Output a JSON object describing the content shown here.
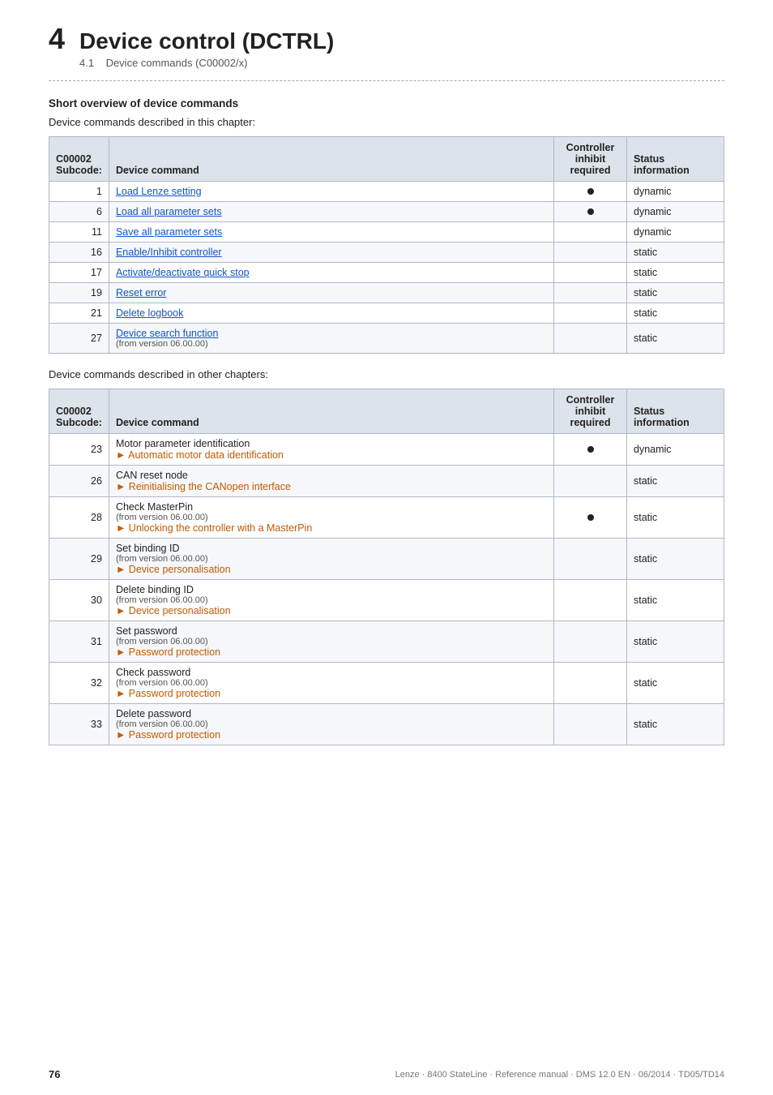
{
  "chapter": {
    "number": "4",
    "title": "Device control (DCTRL)",
    "section_number": "4.1",
    "section_title": "Device commands (C00002/x)"
  },
  "section1": {
    "bold_title": "Short overview of device commands",
    "intro": "Device commands described in this chapter:"
  },
  "table1": {
    "headers": {
      "subcode": "C00002\nSubcode:",
      "command": "Device command",
      "inhibit": "Controller\ninhibit\nrequired",
      "status": "Status information"
    },
    "rows": [
      {
        "subcode": "1",
        "command": "Load Lenze setting",
        "inhibit": true,
        "status": "dynamic",
        "link": true
      },
      {
        "subcode": "6",
        "command": "Load all parameter sets",
        "inhibit": true,
        "status": "dynamic",
        "link": true
      },
      {
        "subcode": "11",
        "command": "Save all parameter sets",
        "inhibit": false,
        "status": "dynamic",
        "link": true
      },
      {
        "subcode": "16",
        "command": "Enable/Inhibit controller",
        "inhibit": false,
        "status": "static",
        "link": true
      },
      {
        "subcode": "17",
        "command": "Activate/deactivate quick stop",
        "inhibit": false,
        "status": "static",
        "link": true
      },
      {
        "subcode": "19",
        "command": "Reset error",
        "inhibit": false,
        "status": "static",
        "link": true
      },
      {
        "subcode": "21",
        "command": "Delete logbook",
        "inhibit": false,
        "status": "static",
        "link": true
      },
      {
        "subcode": "27",
        "command_main": "Device search function",
        "command_sub": "(from version 06.00.00)",
        "inhibit": false,
        "status": "static",
        "link": true,
        "has_sub": true
      }
    ]
  },
  "section2": {
    "intro": "Device commands described in other chapters:"
  },
  "table2": {
    "headers": {
      "subcode": "C00002\nSubcode:",
      "command": "Device command",
      "inhibit": "Controller\ninhibit\nrequired",
      "status": "Status information"
    },
    "rows": [
      {
        "subcode": "23",
        "command_main": "Motor parameter identification",
        "command_sub": null,
        "command_link": "▶ Automatic motor data identification",
        "inhibit": true,
        "status": "dynamic"
      },
      {
        "subcode": "26",
        "command_main": "CAN reset node",
        "command_sub": null,
        "command_link": "▶ Reinitialising the CANopen interface",
        "inhibit": false,
        "status": "static"
      },
      {
        "subcode": "28",
        "command_main": "Check MasterPin",
        "command_sub": "(from version 06.00.00)",
        "command_link": "▶ Unlocking the controller with a MasterPin",
        "inhibit": true,
        "status": "static"
      },
      {
        "subcode": "29",
        "command_main": "Set binding ID",
        "command_sub": "(from version 06.00.00)",
        "command_link": "▶ Device personalisation",
        "inhibit": false,
        "status": "static"
      },
      {
        "subcode": "30",
        "command_main": "Delete binding ID",
        "command_sub": "(from version 06.00.00)",
        "command_link": "▶ Device personalisation",
        "inhibit": false,
        "status": "static"
      },
      {
        "subcode": "31",
        "command_main": "Set password",
        "command_sub": "(from version 06.00.00)",
        "command_link": "▶ Password protection",
        "inhibit": false,
        "status": "static"
      },
      {
        "subcode": "32",
        "command_main": "Check password",
        "command_sub": "(from version 06.00.00)",
        "command_link": "▶ Password protection",
        "inhibit": false,
        "status": "static"
      },
      {
        "subcode": "33",
        "command_main": "Delete password",
        "command_sub": "(from version 06.00.00)",
        "command_link": "▶ Password protection",
        "inhibit": false,
        "status": "static"
      }
    ]
  },
  "footer": {
    "page_number": "76",
    "right_text": "Lenze · 8400 StateLine · Reference manual · DMS 12.0 EN · 06/2014 · TD05/TD14"
  }
}
